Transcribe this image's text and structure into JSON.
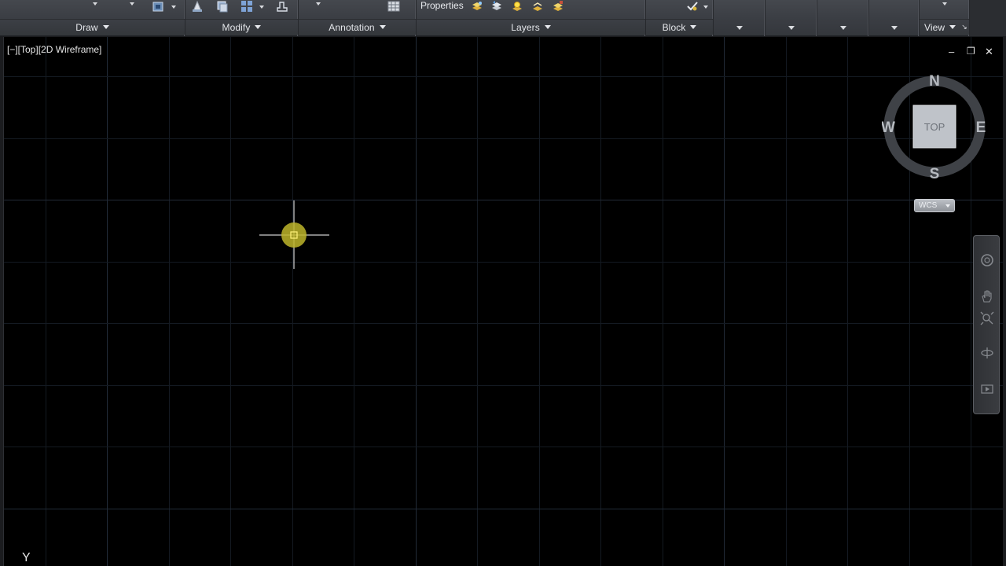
{
  "ribbon": {
    "panels": [
      {
        "id": "draw",
        "label": "Draw"
      },
      {
        "id": "modify",
        "label": "Modify"
      },
      {
        "id": "annotation",
        "label": "Annotation"
      },
      {
        "id": "layers",
        "label": "Layers"
      },
      {
        "id": "block",
        "label": "Block"
      },
      {
        "id": "panel-6",
        "label": ""
      },
      {
        "id": "panel-7",
        "label": ""
      },
      {
        "id": "panel-8",
        "label": ""
      },
      {
        "id": "panel-9",
        "label": ""
      },
      {
        "id": "view",
        "label": "View"
      }
    ],
    "properties_label": "Properties"
  },
  "viewport": {
    "label": "[−][Top][2D Wireframe]",
    "controls": {
      "minimize": "–",
      "restore": "❐",
      "close": "✕"
    }
  },
  "viewcube": {
    "face": "TOP",
    "north": "N",
    "south": "S",
    "east": "E",
    "west": "W",
    "ucs": "WCS"
  },
  "ucs_icon": {
    "axis": "Y"
  },
  "colors": {
    "ribbon_bg": "#3b3e44",
    "canvas_bg": "#000000",
    "grid_major": "#222b38",
    "grid_minor": "#141a22",
    "cursor_marker": "#d4c832",
    "crosshair": "#ffffff"
  },
  "icons": {
    "draw": [
      "region-icon"
    ],
    "modify": [
      "scale-icon",
      "copy-icon",
      "array-icon",
      "stretch-icon"
    ],
    "annotation": [
      "table-icon"
    ],
    "layers": [
      "layer-match-icon",
      "layer-previous-icon",
      "layer-on-icon",
      "layer-off-icon",
      "layer-lock-icon"
    ],
    "block": [
      "insert-block-icon"
    ],
    "navbar": [
      "steering-wheel-icon",
      "pan-icon",
      "zoom-extents-icon",
      "orbit-icon",
      "showmotion-icon"
    ]
  }
}
